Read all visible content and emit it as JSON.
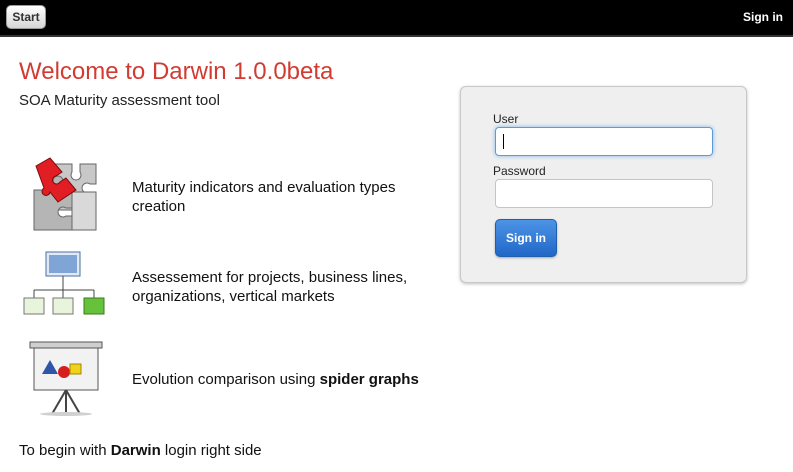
{
  "header": {
    "start_label": "Start",
    "signin_link": "Sign in"
  },
  "main": {
    "title": "Welcome to Darwin 1.0.0beta",
    "subtitle": "SOA Maturity assessment tool",
    "features": [
      {
        "icon": "puzzle-icon",
        "text": "Maturity indicators and evaluation types creation"
      },
      {
        "icon": "hierarchy-icon",
        "text": "Assessement for projects, business lines, organizations, vertical markets"
      },
      {
        "icon": "presentation-board-icon",
        "text_prefix": "Evolution comparison using ",
        "text_bold": "spider graphs"
      }
    ],
    "footer": {
      "prefix": "To begin with ",
      "bold": "Darwin",
      "suffix": " login right side"
    }
  },
  "login": {
    "user_label": "User",
    "user_value": "",
    "password_label": "Password",
    "password_value": "",
    "submit_label": "Sign in"
  },
  "colors": {
    "title": "#d23b32",
    "topbar": "#000000",
    "button": "#2f7bd8"
  }
}
